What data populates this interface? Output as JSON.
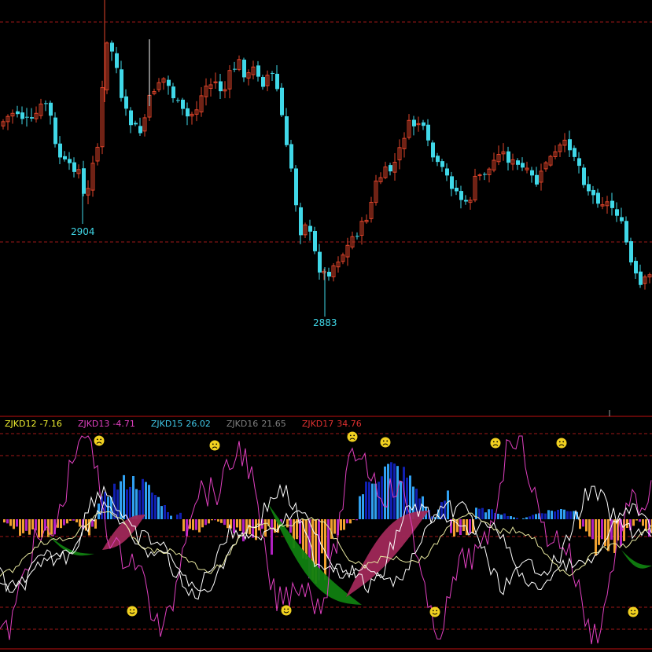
{
  "colors": {
    "background": "#000000",
    "up_candle": "#e0442a",
    "down_candle": "#40d8e8",
    "separator": "#c01010",
    "grid_dash": "#a01818",
    "label_cyan": "#40d8e8",
    "zjkd12": "#f0f030",
    "zjkd13": "#e040c0",
    "zjkd15": "#40c8e8",
    "zjkd16": "#808080",
    "zjkd17": "#e03030",
    "bar_orange": "#f0a030",
    "bar_magenta": "#b020c0",
    "bar_blue_dark": "#1020b0",
    "bar_blue_light": "#30a0f0",
    "band_green": "#108010",
    "band_maroon": "#a02858",
    "smiley": "#f0d020"
  },
  "legend": [
    {
      "name": "ZJKD12",
      "value": "-7.16",
      "color_key": "zjkd12"
    },
    {
      "name": "ZJKD13",
      "value": "-4.71",
      "color_key": "zjkd13"
    },
    {
      "name": "ZJKD15",
      "value": "26.02",
      "color_key": "zjkd15"
    },
    {
      "name": "ZJKD16",
      "value": "21.65",
      "color_key": "zjkd16"
    },
    {
      "name": "ZJKD17",
      "value": "34.76",
      "color_key": "zjkd17"
    }
  ],
  "chart_data": [
    {
      "type": "candlestick",
      "annotations": [
        {
          "text": "2904",
          "kind": "low-marker"
        },
        {
          "text": "2883",
          "kind": "low-marker"
        }
      ],
      "grid": "dashed horizontal",
      "candles_visible": 96
    },
    {
      "type": "indicator",
      "series": [
        {
          "name": "ZJKD12",
          "last": -7.16
        },
        {
          "name": "ZJKD13",
          "last": -4.71
        },
        {
          "name": "ZJKD15",
          "last": 26.02
        },
        {
          "name": "ZJKD16",
          "last": 21.65
        },
        {
          "name": "ZJKD17",
          "last": 34.76
        }
      ],
      "markers": {
        "top_smiles": 6,
        "bottom_smiles": 4
      }
    }
  ]
}
